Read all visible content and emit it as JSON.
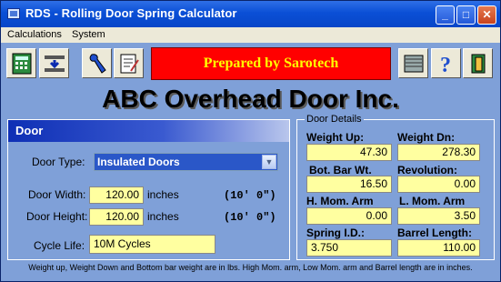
{
  "window": {
    "title": "RDS - Rolling Door Spring Calculator"
  },
  "menu": [
    "Calculations",
    "System"
  ],
  "banner": "Prepared by Sarotech",
  "company": "ABC Overhead Door Inc.",
  "door": {
    "header": "Door",
    "type_label": "Door Type:",
    "type_value": "Insulated Doors",
    "width_label": "Door Width:",
    "width_value": "120.00",
    "width_unit": "inches",
    "width_feet": "(10' 0\")",
    "height_label": "Door Height:",
    "height_value": "120.00",
    "height_unit": "inches",
    "height_feet": "(10' 0\")",
    "cycle_label": "Cycle Life:",
    "cycle_value": "10M Cycles"
  },
  "details": {
    "title": "Door Details",
    "weight_up_label": "Weight Up:",
    "weight_up": "47.30",
    "weight_dn_label": "Weight Dn:",
    "weight_dn": "278.30",
    "bot_bar_label": "Bot. Bar Wt.",
    "bot_bar": "16.50",
    "revolution_label": "Revolution:",
    "revolution": "0.00",
    "h_mom_label": "H. Mom. Arm",
    "h_mom": "0.00",
    "l_mom_label": "L. Mom. Arm",
    "l_mom": "3.50",
    "spring_id_label": "Spring I.D.:",
    "spring_id": "3.750",
    "barrel_label": "Barrel Length:",
    "barrel": "110.00"
  },
  "footnote": "Weight up, Weight Down and Bottom bar weight are in lbs. High Mom. arm, Low Mom. arm and Barrel length are in inches.",
  "icons": [
    "calculator-icon",
    "spring-list-icon",
    "tools-icon",
    "report-icon",
    "door-icon",
    "help-icon",
    "exit-icon"
  ],
  "colors": {
    "accent": "#ff0000",
    "banner_text": "#ffff00",
    "field": "#ffffa0",
    "panel": "#7fa0d8"
  }
}
